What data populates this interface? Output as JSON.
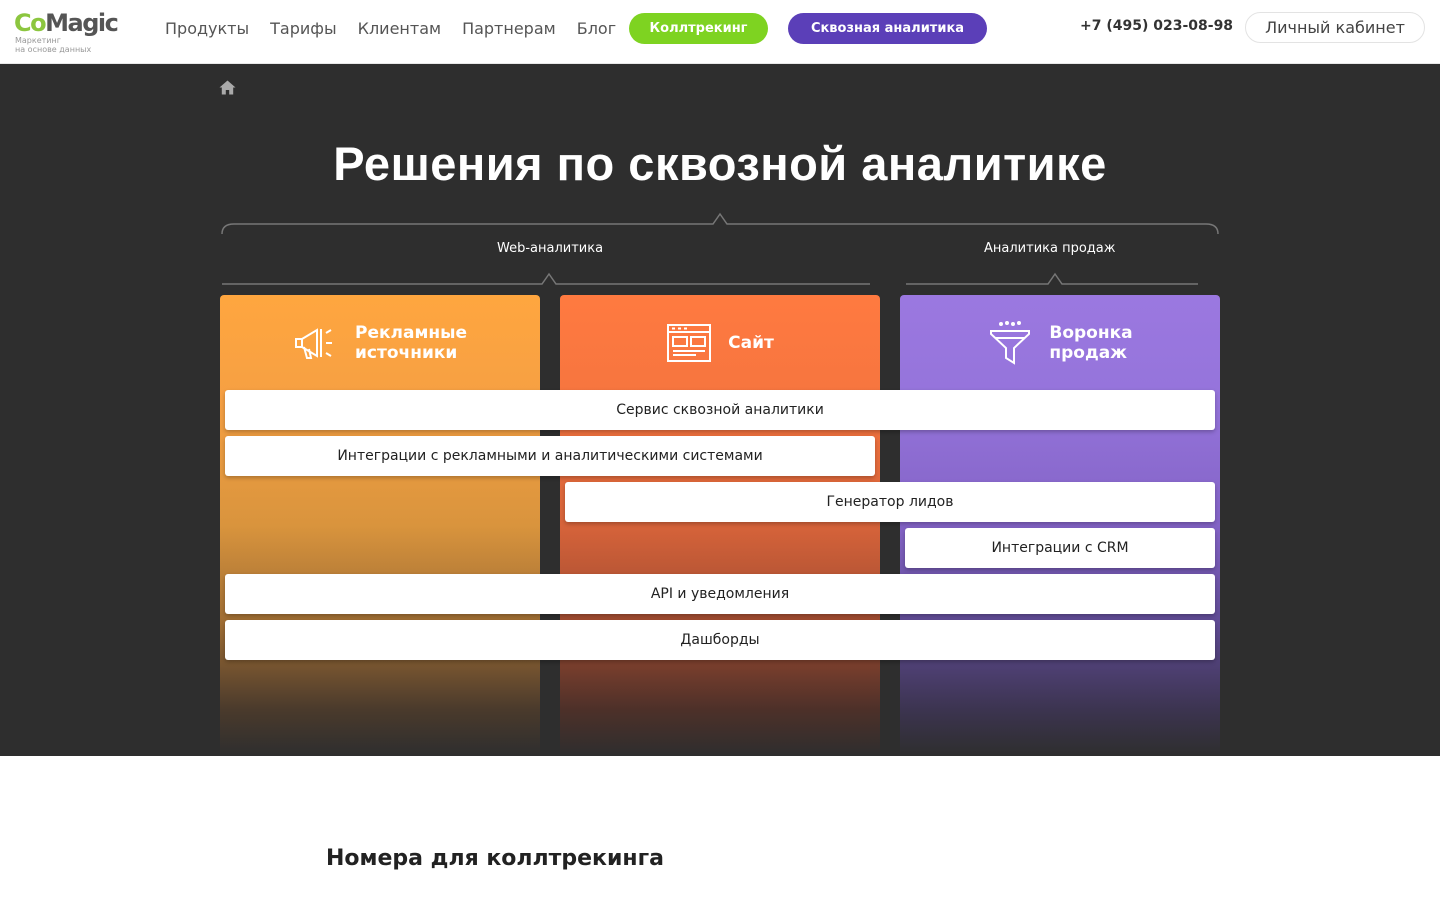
{
  "header": {
    "logo": {
      "co": "Co",
      "magic": "Magic",
      "tagline_line1": "Маркетинг",
      "tagline_line2": "на основе данных"
    },
    "nav": [
      "Продукты",
      "Тарифы",
      "Клиентам",
      "Партнерам",
      "Блог"
    ],
    "pill_calltracking": "Коллтрекинг",
    "pill_analytics": "Сквозная аналитика",
    "phone": "+7 (495) 023-08-98",
    "account": "Личный кабинет"
  },
  "hero": {
    "title": "Решения по сквозной аналитике",
    "categories": {
      "web": "Web-аналитика",
      "sales": "Аналитика продаж"
    },
    "columns": [
      {
        "label": "Рекламные\nисточники",
        "icon": "megaphone-icon"
      },
      {
        "label": "Сайт",
        "icon": "website-icon"
      },
      {
        "label": "Воронка\nпродаж",
        "icon": "funnel-icon"
      }
    ],
    "bars": [
      "Сервис сквозной аналитики",
      "Интеграции с рекламными и аналитическими системами",
      "Генератор лидов",
      "Интеграции с CRM",
      "API и уведомления",
      "Дашборды"
    ]
  },
  "next_section": {
    "title": "Номера для коллтрекинга"
  },
  "colors": {
    "green": "#7ed321",
    "purple": "#5b3fb8",
    "orange": "#ffa63f",
    "red_orange": "#ff7a40",
    "violet": "#9b78e0",
    "dark_bg": "#2e2e2e"
  }
}
